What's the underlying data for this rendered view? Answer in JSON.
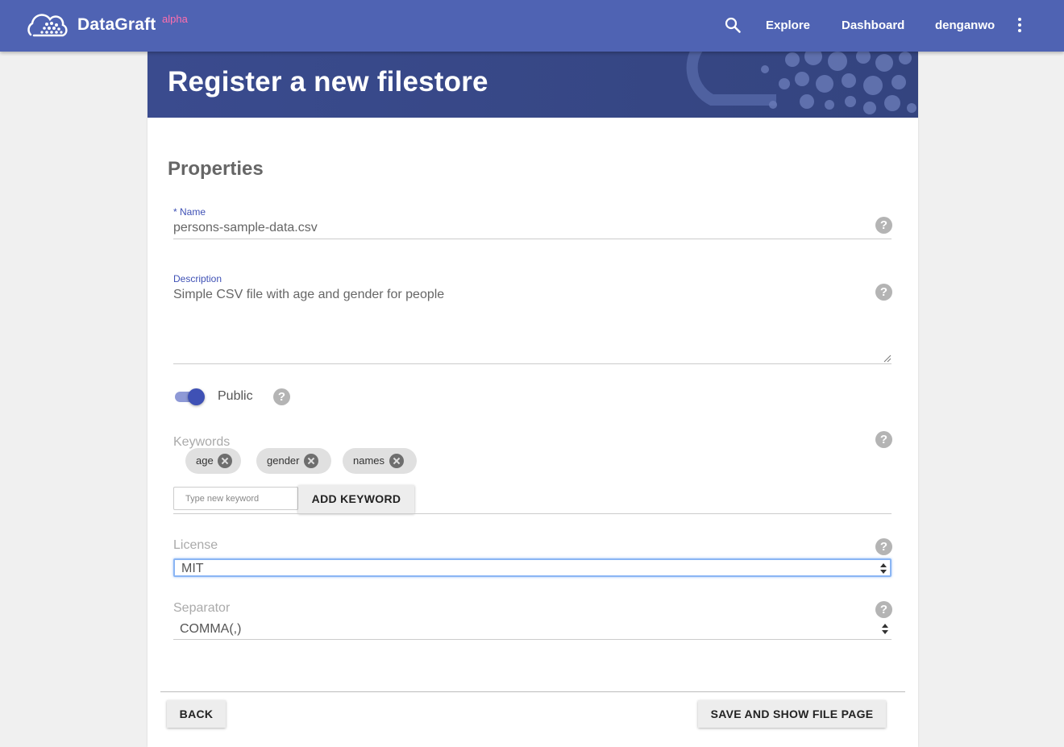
{
  "app": {
    "brand": "DataGraft",
    "brand_sup": "alpha",
    "nav": {
      "explore": "Explore",
      "dashboard": "Dashboard",
      "user": "denganwo"
    }
  },
  "page": {
    "title": "Register a new filestore",
    "section_title": "Properties"
  },
  "form": {
    "name": {
      "label": "* Name",
      "value": "persons-sample-data.csv"
    },
    "description": {
      "label": "Description",
      "value": "Simple CSV file with age and gender for people"
    },
    "public": {
      "label": "Public",
      "checked": true
    },
    "keywords": {
      "label": "Keywords",
      "items": [
        "age",
        "gender",
        "names"
      ],
      "input_placeholder": "Type new keyword",
      "add_button": "ADD KEYWORD"
    },
    "license": {
      "label": "License",
      "selected": "MIT"
    },
    "separator": {
      "label": "Separator",
      "selected": "COMMA(,)"
    },
    "help_glyph": "?"
  },
  "footer": {
    "back_button": "BACK",
    "save_button": "SAVE AND SHOW FILE PAGE"
  },
  "colors": {
    "appbar": "#4f63b3",
    "accent": "#3f51b5",
    "brand_sup": "#ff6fae",
    "hero": "#3c4d92"
  },
  "icons": {
    "logo": "cloud-dots-logo",
    "search": "search-icon",
    "more": "more-vert-icon",
    "help": "help-circle-icon",
    "chip_remove": "close-circle-icon"
  }
}
